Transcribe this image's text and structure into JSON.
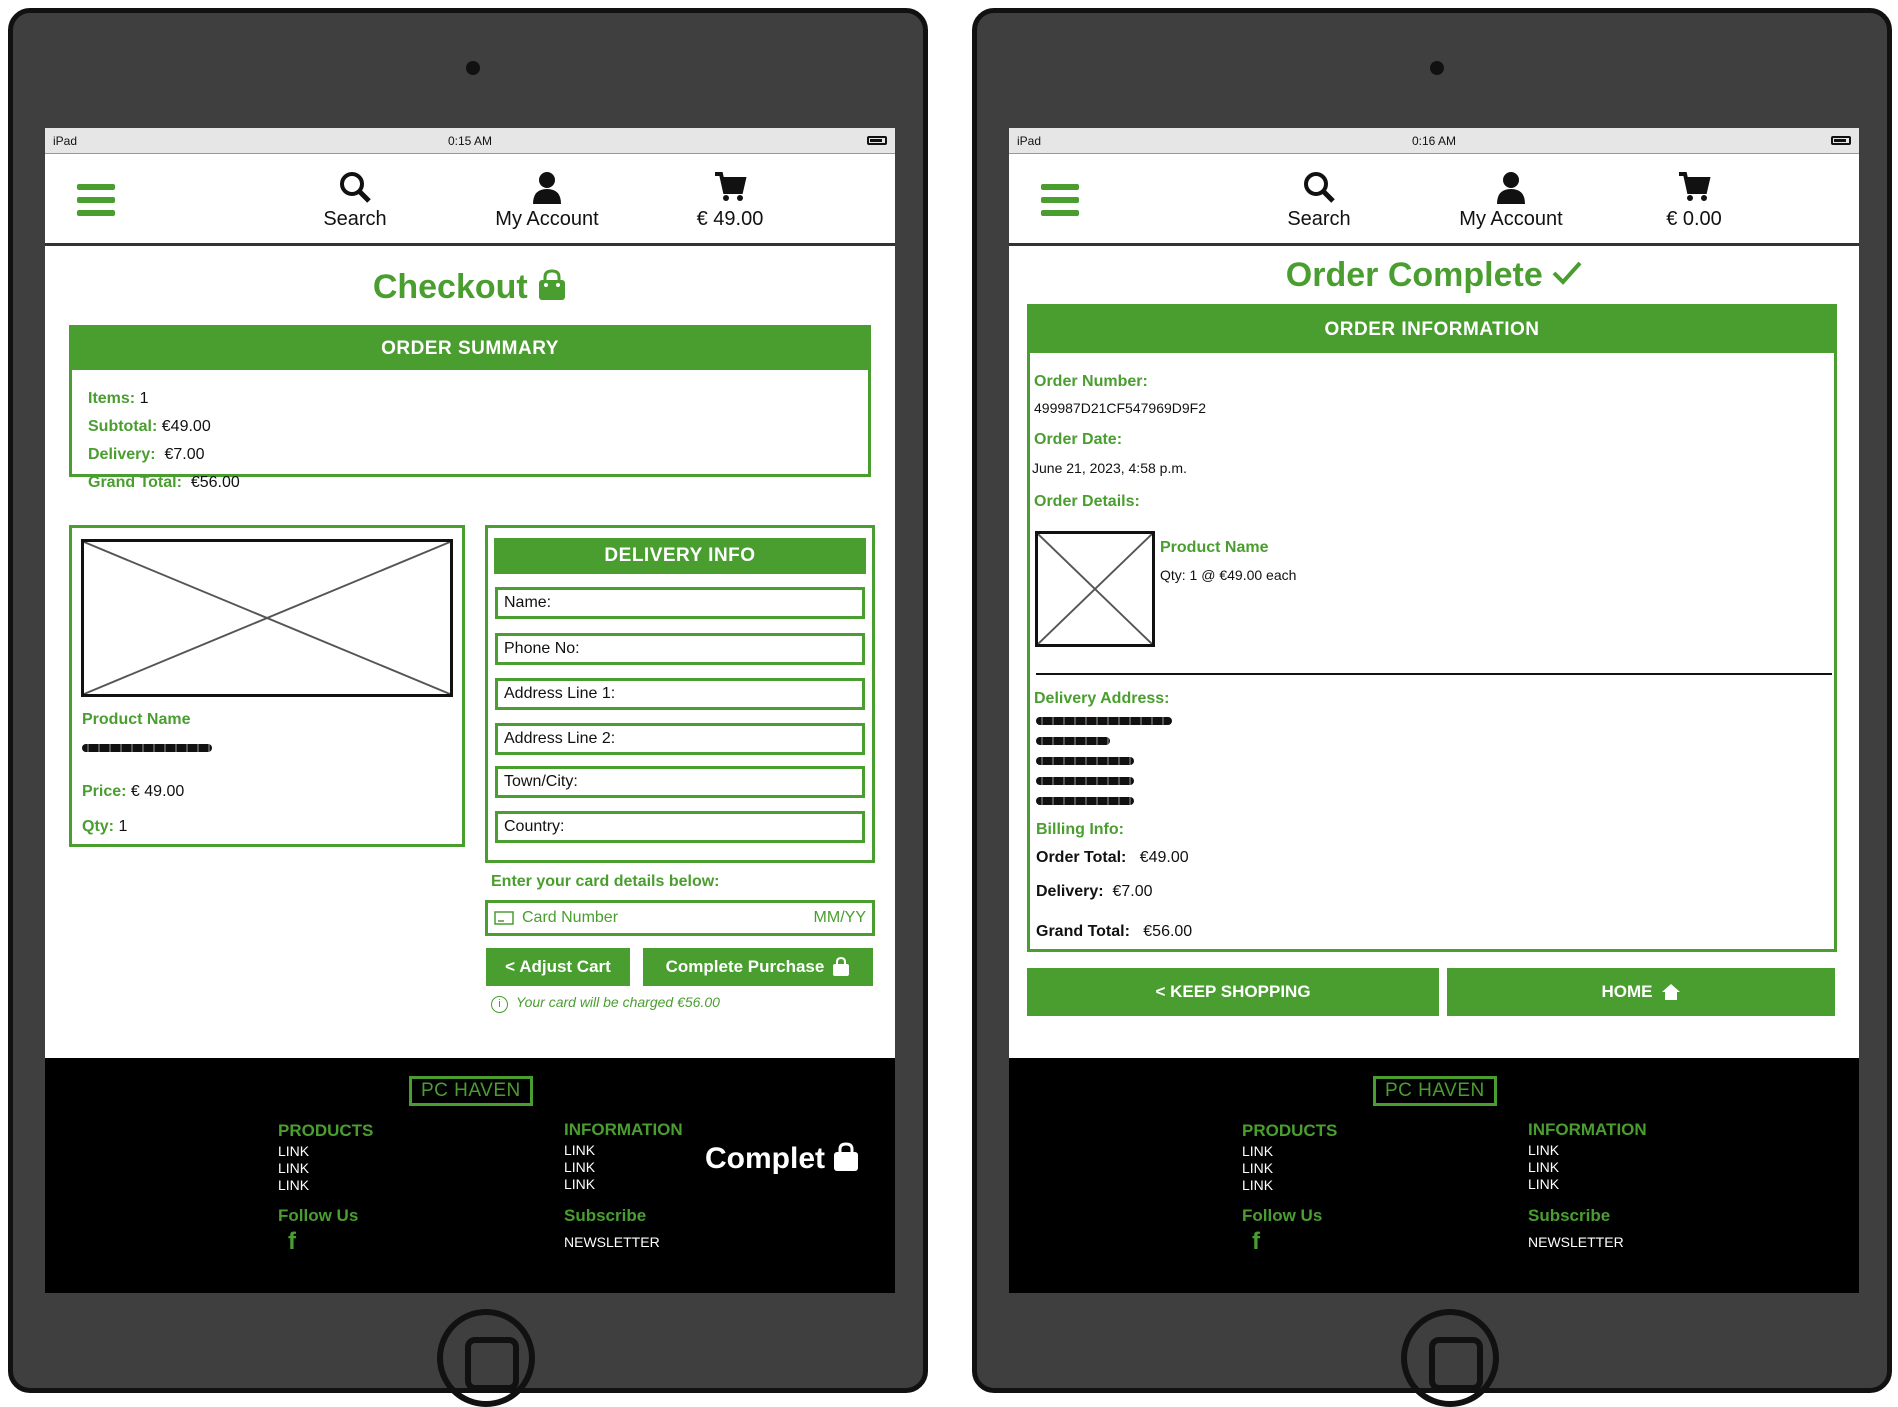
{
  "left": {
    "status": {
      "carrier": "iPad",
      "time": "0:15 AM"
    },
    "nav": {
      "search": "Search",
      "account": "My Account",
      "cart": "€ 49.00"
    },
    "title": "Checkout",
    "order_summary": {
      "heading": "ORDER SUMMARY",
      "items_label": "Items:",
      "items_value": "1",
      "subtotal_label": "Subtotal:",
      "subtotal_value": "€49.00",
      "delivery_label": "Delivery:",
      "delivery_value": "€7.00",
      "grand_label": "Grand Total:",
      "grand_value": "€56.00"
    },
    "product": {
      "name": "Product Name",
      "price_label": "Price:",
      "price_value": "€ 49.00",
      "qty_label": "Qty:",
      "qty_value": "1"
    },
    "delivery_info": {
      "heading": "DELIVERY INFO",
      "fields": [
        "Name:",
        "Phone No:",
        "Address Line 1:",
        "Address Line 2:",
        "Town/City:",
        "Country:"
      ]
    },
    "card": {
      "prompt": "Enter your card details below:",
      "number_placeholder": "Card Number",
      "expiry_placeholder": "MM/YY"
    },
    "buttons": {
      "adjust": "< Adjust Cart",
      "complete": "Complete Purchase"
    },
    "charge_note": "Your card will be charged €56.00",
    "overlay_text": "Complet"
  },
  "right": {
    "status": {
      "carrier": "iPad",
      "time": "0:16 AM"
    },
    "nav": {
      "search": "Search",
      "account": "My Account",
      "cart": "€ 0.00"
    },
    "title": "Order Complete",
    "order_info": {
      "heading": "ORDER INFORMATION",
      "number_label": "Order Number:",
      "number_value": "499987D21CF547969D9F2",
      "date_label": "Order Date:",
      "date_value": "June 21, 2023, 4:58 p.m.",
      "details_label": "Order Details:",
      "product_name": "Product Name",
      "product_qty": "Qty: 1 @ €49.00 each",
      "address_label": "Delivery Address:",
      "billing_label": "Billing Info:",
      "total_label": "Order Total:",
      "total_value": "€49.00",
      "delivery_label": "Delivery:",
      "delivery_value": "€7.00",
      "grand_label": "Grand Total:",
      "grand_value": "€56.00"
    },
    "buttons": {
      "keep": "< KEEP SHOPPING",
      "home": "HOME"
    }
  },
  "footer": {
    "logo": "PC HAVEN",
    "products_heading": "PRODUCTS",
    "information_heading": "INFORMATION",
    "links": [
      "LINK",
      "LINK",
      "LINK"
    ],
    "follow": "Follow Us",
    "subscribe": "Subscribe",
    "newsletter": "NEWSLETTER"
  },
  "colors": {
    "accent": "#4a9e30",
    "device": "#3f3f3f"
  }
}
